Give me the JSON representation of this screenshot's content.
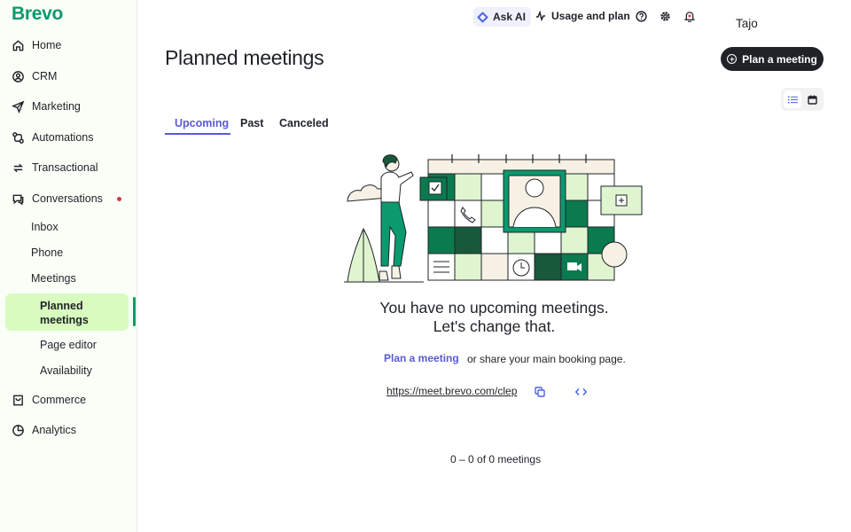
{
  "app": {
    "logo": "Brevo",
    "user": "Tajo"
  },
  "topbar": {
    "ask_ai": "Ask AI",
    "usage": "Usage and plan"
  },
  "sidebar": {
    "items": [
      {
        "label": "Home",
        "icon": "home-icon"
      },
      {
        "label": "CRM",
        "icon": "crm-icon"
      },
      {
        "label": "Marketing",
        "icon": "send-icon"
      },
      {
        "label": "Automations",
        "icon": "automations-icon"
      },
      {
        "label": "Transactional",
        "icon": "transactional-icon"
      },
      {
        "label": "Conversations",
        "icon": "chat-icon"
      }
    ],
    "conversations_sub": [
      "Inbox",
      "Phone",
      "Meetings"
    ],
    "meetings_sub": [
      "Planned meetings",
      "Page editor",
      "Availability"
    ],
    "bottom_items": [
      {
        "label": "Commerce",
        "icon": "cart-icon"
      },
      {
        "label": "Analytics",
        "icon": "analytics-icon"
      }
    ]
  },
  "page": {
    "title": "Planned meetings",
    "plan_button": "Plan a meeting",
    "tabs": [
      "Upcoming",
      "Past",
      "Canceled"
    ],
    "active_tab": "Upcoming"
  },
  "empty_state": {
    "title_line1": "You have no upcoming meetings.",
    "title_line2": "Let's change that.",
    "plan_link": "Plan a meeting",
    "share_text": "or share your main booking page.",
    "booking_url": "https://meet.brevo.com/clep"
  },
  "footer": {
    "count": "0 – 0 of 0 meetings"
  },
  "colors": {
    "brand": "#0b996e",
    "accent": "#5a5bd3",
    "active_bg": "#d9fbbf",
    "dark": "#1f2328"
  }
}
